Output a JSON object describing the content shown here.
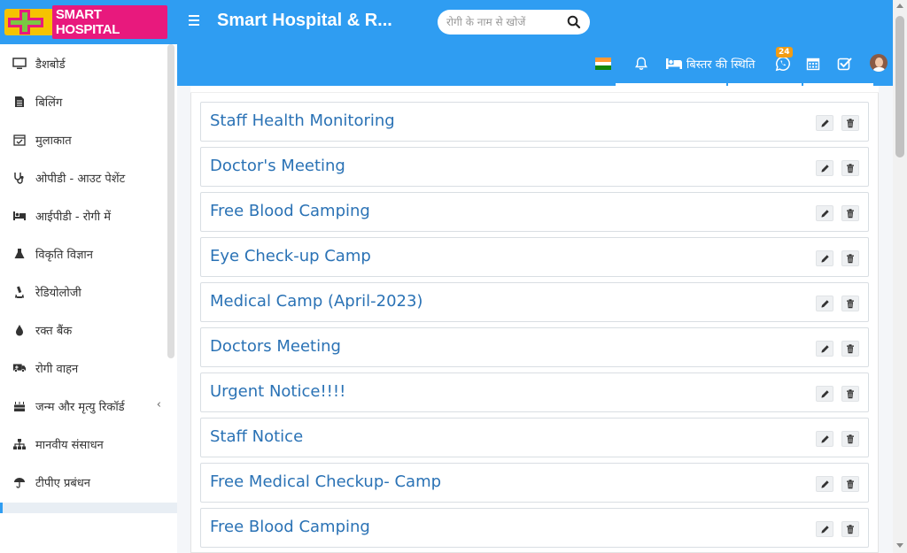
{
  "header": {
    "logo_text": "SMART HOSPITAL",
    "app_title": "Smart Hospital & R...",
    "search_placeholder": "रोगी के नाम से खोजें"
  },
  "navbar": {
    "bed_status_label": "बिस्तर की स्थिति",
    "whatsapp_badge": "24"
  },
  "sidebar": {
    "items": [
      {
        "label": "डैशबोर्ड",
        "icon": "monitor-icon"
      },
      {
        "label": "बिलिंग",
        "icon": "bill-icon"
      },
      {
        "label": "मुलाकात",
        "icon": "calendar-check-icon"
      },
      {
        "label": "ओपीडी - आउट पेशेंट",
        "icon": "stethoscope-icon"
      },
      {
        "label": "आईपीडी - रोगी में",
        "icon": "bed-icon"
      },
      {
        "label": "विकृति विज्ञान",
        "icon": "flask-icon"
      },
      {
        "label": "रेडियोलोजी",
        "icon": "microscope-icon"
      },
      {
        "label": "रक्त बैंक",
        "icon": "tint-icon"
      },
      {
        "label": "रोगी वाहन",
        "icon": "ambulance-icon"
      },
      {
        "label": "जन्म और मृत्यु रिकॉर्ड",
        "icon": "birthday-cake-icon",
        "has_children": true
      },
      {
        "label": "मानवीय संसाधन",
        "icon": "sitemap-icon"
      },
      {
        "label": "टीपीए प्रबंधन",
        "icon": "umbrella-icon"
      }
    ]
  },
  "notices": [
    {
      "title": "Staff Health Monitoring"
    },
    {
      "title": "Doctor's Meeting"
    },
    {
      "title": "Free Blood Camping"
    },
    {
      "title": "Eye Check-up Camp"
    },
    {
      "title": "Medical Camp (April-2023)"
    },
    {
      "title": "Doctors Meeting"
    },
    {
      "title": "Urgent Notice!!!!"
    },
    {
      "title": "Staff Notice"
    },
    {
      "title": "Free Medical Checkup- Camp"
    },
    {
      "title": "Free Blood Camping"
    }
  ],
  "colors": {
    "primary": "#2f9df2",
    "link": "#2a72b5",
    "logo_yellow": "#f6c300",
    "logo_pink": "#e8197d",
    "badge": "#f39c12"
  }
}
